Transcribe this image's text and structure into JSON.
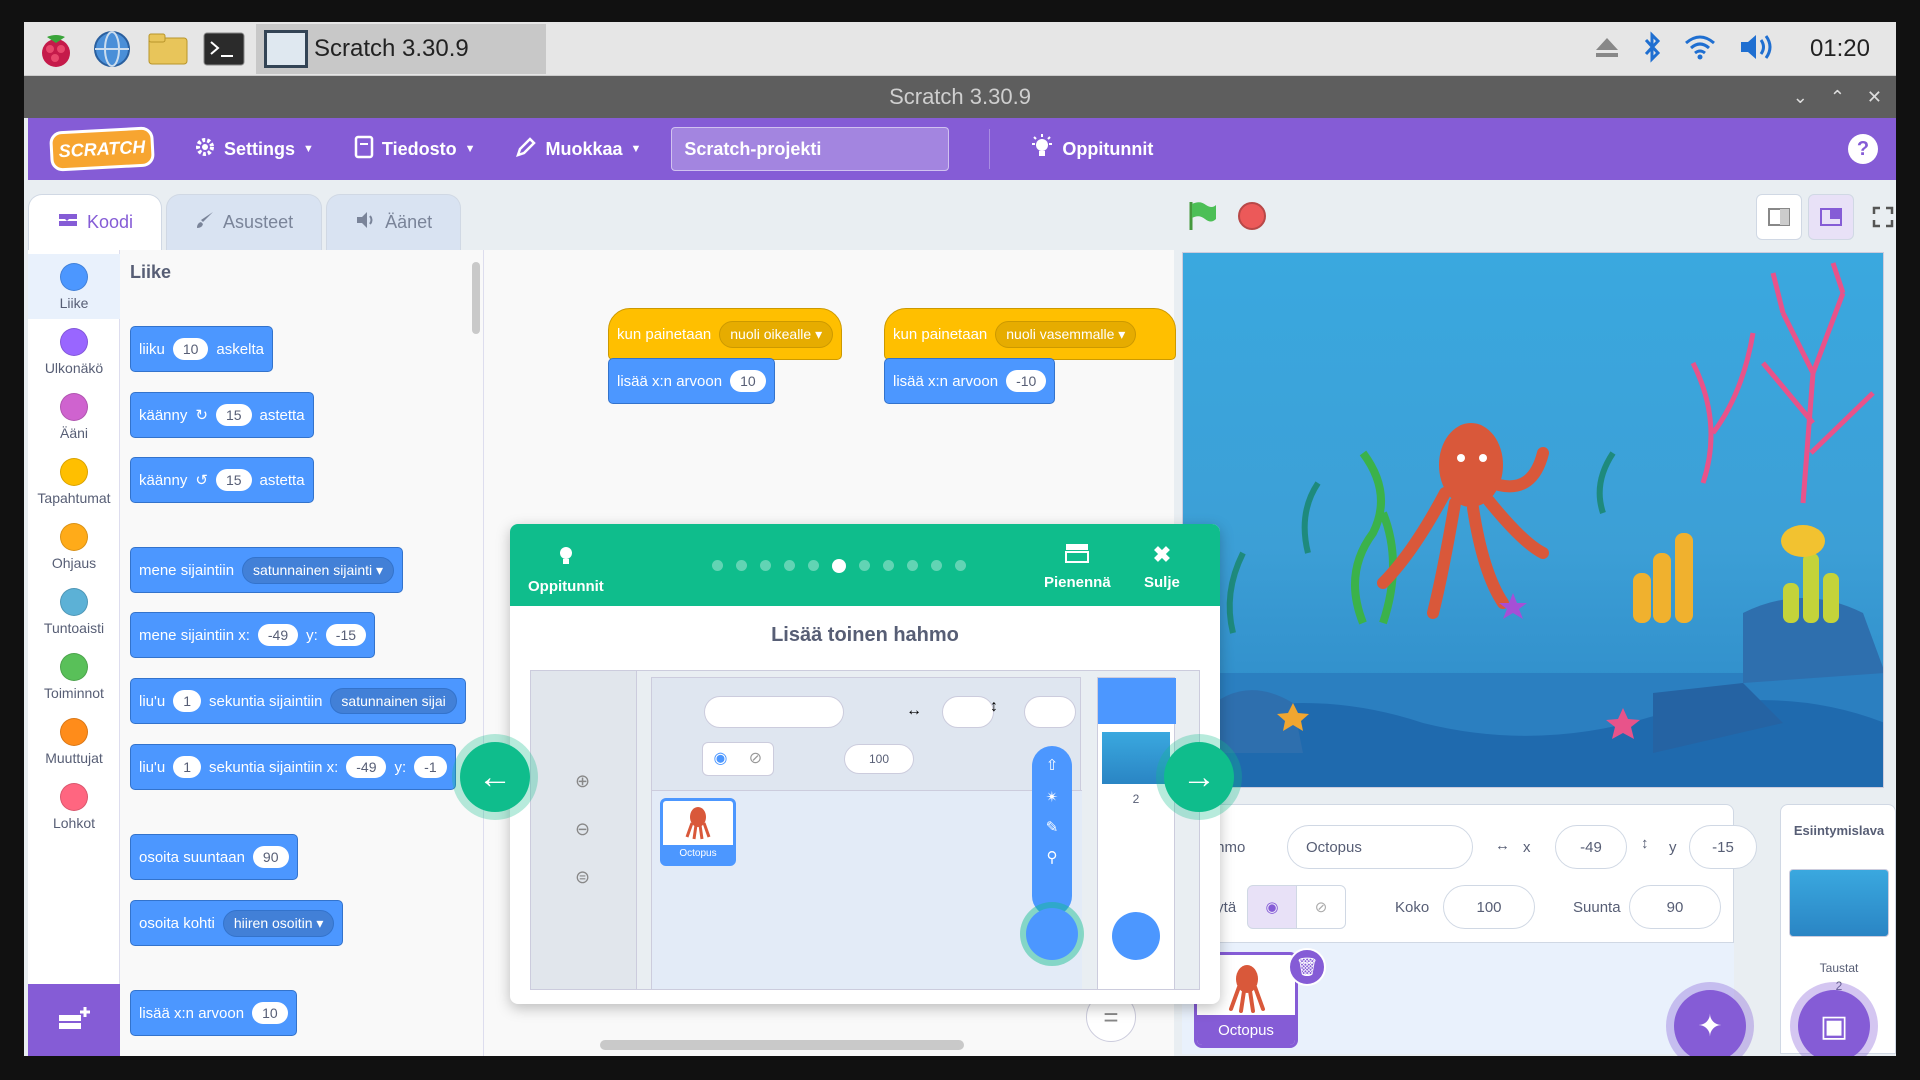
{
  "os": {
    "task_title": "Scratch 3.30.9",
    "clock": "01:20"
  },
  "window": {
    "title": "Scratch 3.30.9"
  },
  "menu": {
    "logo": "SCRATCH",
    "settings": "Settings",
    "file": "Tiedosto",
    "edit": "Muokkaa",
    "project_title": "Scratch-projekti",
    "tutorials": "Oppitunnit"
  },
  "tabs": {
    "code": "Koodi",
    "costumes": "Asusteet",
    "sounds": "Äänet"
  },
  "categories": [
    {
      "label": "Liike",
      "color": "#4c97ff"
    },
    {
      "label": "Ulkonäkö",
      "color": "#9966ff"
    },
    {
      "label": "Ääni",
      "color": "#cf63cf"
    },
    {
      "label": "Tapahtumat",
      "color": "#ffbf00"
    },
    {
      "label": "Ohjaus",
      "color": "#ffab19"
    },
    {
      "label": "Tuntoaisti",
      "color": "#5cb1d6"
    },
    {
      "label": "Toiminnot",
      "color": "#59c059"
    },
    {
      "label": "Muuttujat",
      "color": "#ff8c1a"
    },
    {
      "label": "Lohkot",
      "color": "#ff6680"
    }
  ],
  "palette": {
    "title": "Liike",
    "move": {
      "a": "liiku",
      "n": "10",
      "b": "askelta"
    },
    "turn_right": {
      "a": "käänny",
      "n": "15",
      "b": "astetta"
    },
    "turn_left": {
      "a": "käänny",
      "n": "15",
      "b": "astetta"
    },
    "goto": {
      "a": "mene sijaintiin",
      "dd": "satunnainen sijainti"
    },
    "goto_xy": {
      "a": "mene sijaintiin x:",
      "x": "-49",
      "yl": "y:",
      "y": "-15"
    },
    "glide": {
      "a": "liu'u",
      "n": "1",
      "b": "sekuntia sijaintiin",
      "dd": "satunnainen sijai"
    },
    "glide_xy": {
      "a": "liu'u",
      "n": "1",
      "b": "sekuntia sijaintiin x:",
      "x": "-49",
      "yl": "y:",
      "y": "-1"
    },
    "point_dir": {
      "a": "osoita suuntaan",
      "n": "90"
    },
    "point_towards": {
      "a": "osoita kohti",
      "dd": "hiiren osoitin"
    },
    "change_x": {
      "a": "lisää x:n arvoon",
      "n": "10"
    }
  },
  "scripts": [
    {
      "hat": "kun painetaan",
      "key": "nuoli oikealle",
      "cmd": "lisää x:n arvoon",
      "val": "10"
    },
    {
      "hat": "kun painetaan",
      "key": "nuoli vasemmalle",
      "cmd": "lisää x:n arvoon",
      "val": "-10"
    }
  ],
  "tutorial": {
    "label": "Oppitunnit",
    "shrink": "Pienennä",
    "close": "Sulje",
    "title": "Lisää toinen hahmo",
    "video": {
      "size": "100",
      "sprite": "Octopus",
      "count": "2"
    }
  },
  "sprite_info": {
    "sprite_label": "Hahmo",
    "sprite_name": "Octopus",
    "x_label": "x",
    "x": "-49",
    "y_label": "y",
    "y": "-15",
    "show_label": "Näytä",
    "size_label": "Koko",
    "size": "100",
    "direction_label": "Suunta",
    "direction": "90"
  },
  "sprite_list": [
    {
      "name": "Octopus"
    }
  ],
  "stage_panel": {
    "title": "Esiintymislava",
    "backdrops_label": "Taustat",
    "count": "2"
  }
}
